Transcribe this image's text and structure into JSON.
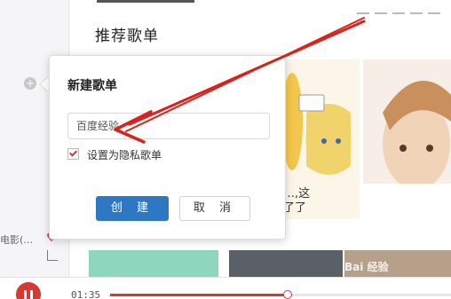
{
  "sidebar": {
    "playing_song_label": "电影(…",
    "add_icon": "plus-circle-icon",
    "like_icon": "heart-icon",
    "share_icon": "share-icon"
  },
  "main": {
    "section_title": "推荐歌单",
    "cards": [
      {
        "caption": ""
      },
      {
        "caption": "…,这\n了了"
      },
      {
        "caption": ""
      }
    ]
  },
  "player": {
    "current_time": "01:35",
    "progress_fraction": 0.52,
    "play_icon": "pause-icon"
  },
  "dialog": {
    "title": "新建歌单",
    "name_input_value": "百度经验",
    "private_checkbox_checked": true,
    "private_checkbox_label": "设置为隐私歌单",
    "create_button_label": "创 建",
    "cancel_button_label": "取 消"
  },
  "watermark": {
    "text": "Bai 经验"
  },
  "colors": {
    "accent": "#d33a31",
    "primary_button": "#2e77c5",
    "annotation_arrow": "#d9221c"
  }
}
